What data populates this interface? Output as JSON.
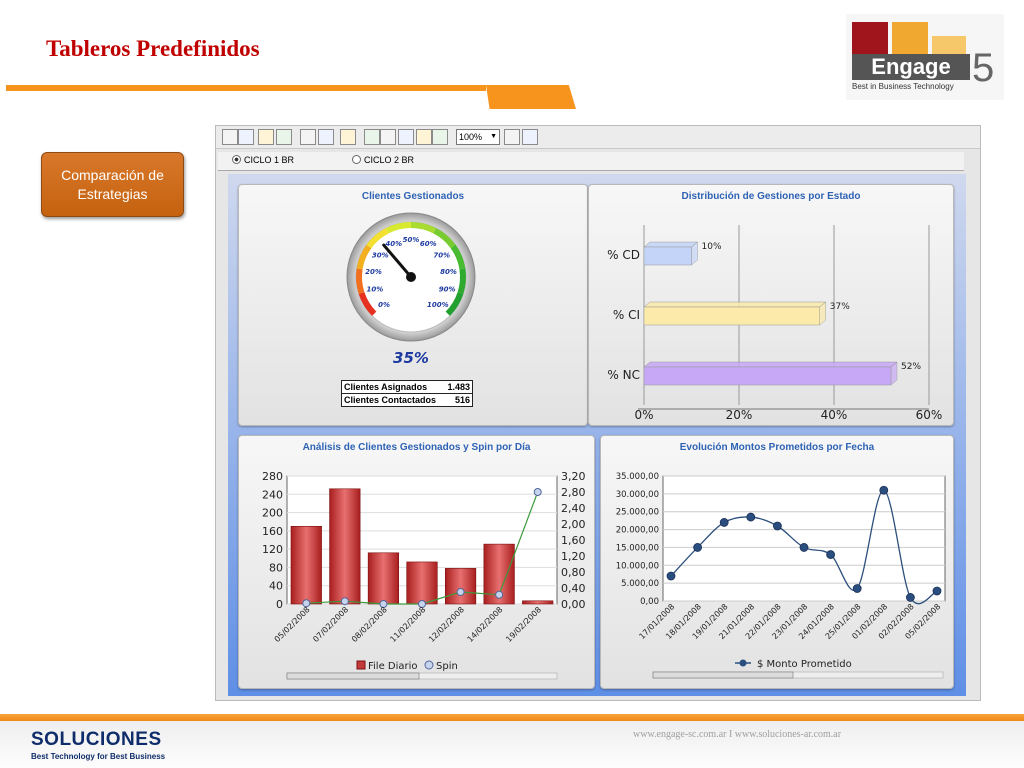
{
  "slide": {
    "title": "Tableros Predefinidos"
  },
  "logo": {
    "word": "Engage",
    "number": "5",
    "reg": "®",
    "tagline": "Best in Business Technology",
    "colors": [
      "#a0151c",
      "#f0a830",
      "#f6c86a"
    ]
  },
  "side_button": {
    "line1": "Comparación de",
    "line2": "Estrategias"
  },
  "app": {
    "zoom": "100%",
    "radio_options": [
      {
        "label": "CICLO 1 BR",
        "selected": true
      },
      {
        "label": "CICLO 2 BR",
        "selected": false
      }
    ],
    "toolbar_icons": [
      "edit-icon",
      "new-page-icon",
      "select-icon",
      "page-icon",
      "save-icon",
      "print-icon",
      "settings-icon",
      "refresh-icon",
      "help-icon",
      "document-icon",
      "export-icon",
      "pdf-icon",
      "export-excel-icon",
      "import-icon"
    ]
  },
  "panels": {
    "gauge": {
      "title": "Clientes Gestionados",
      "value_label": "35%",
      "value": 35,
      "ticks": [
        "0%",
        "10%",
        "20%",
        "30%",
        "40%",
        "50%",
        "60%",
        "70%",
        "80%",
        "90%",
        "100%"
      ],
      "table": [
        {
          "label": "Clientes Asignados",
          "value": "1.483"
        },
        {
          "label": "Clientes Contactados",
          "value": "516"
        }
      ]
    },
    "distribution": {
      "title": "Distribución de Gestiones por Estado"
    },
    "analysis": {
      "title": "Análisis de Clientes Gestionados y Spin por Día",
      "legend": [
        "File Diario",
        "Spin"
      ]
    },
    "evolution": {
      "title": "Evolución Montos Prometidos por Fecha",
      "legend": "$ Monto Prometido"
    }
  },
  "chart_data": [
    {
      "type": "bar",
      "title": "Distribución de Gestiones por Estado",
      "orientation": "horizontal",
      "categories": [
        "% CD",
        "% CI",
        "% NC"
      ],
      "values": [
        10,
        37,
        52
      ],
      "data_labels": [
        "10%",
        "37%",
        "52%"
      ],
      "colors": [
        "#c4d4f8",
        "#fbeaaa",
        "#c7a8f6"
      ],
      "x_ticks": [
        "0%",
        "20%",
        "40%",
        "60%"
      ],
      "xlim": [
        0,
        60
      ]
    },
    {
      "type": "bar",
      "title": "Análisis de Clientes Gestionados y Spin por Día",
      "categories": [
        "05/02/2008",
        "07/02/2008",
        "08/02/2008",
        "11/02/2008",
        "12/02/2008",
        "14/02/2008",
        "19/02/2008"
      ],
      "series": [
        {
          "name": "File Diario",
          "type": "bar",
          "axis": "left",
          "values": [
            170,
            252,
            112,
            92,
            78,
            131,
            7
          ],
          "color": "#c43a3a"
        },
        {
          "name": "Spin",
          "type": "line",
          "axis": "right",
          "values": [
            0.02,
            0.07,
            0.0,
            0.0,
            0.3,
            0.23,
            2.8
          ],
          "color": "#3a9a3a"
        }
      ],
      "y_ticks_left": [
        "0",
        "40",
        "80",
        "120",
        "160",
        "200",
        "240",
        "280"
      ],
      "y_ticks_right": [
        "0,00",
        "0,40",
        "0,80",
        "1,20",
        "1,60",
        "2,00",
        "2,40",
        "2,80",
        "3,20"
      ],
      "ylim_left": [
        0,
        280
      ],
      "ylim_right": [
        0,
        3.2
      ],
      "grid": true
    },
    {
      "type": "line",
      "title": "Evolución Montos Prometidos por Fecha",
      "categories": [
        "17/01/2008",
        "18/01/2008",
        "19/01/2008",
        "21/01/2008",
        "22/01/2008",
        "23/01/2008",
        "24/01/2008",
        "25/01/2008",
        "01/02/2008",
        "02/02/2008",
        "05/02/2008"
      ],
      "series": [
        {
          "name": "$ Monto Prometido",
          "values": [
            7000,
            15000,
            22000,
            23500,
            21000,
            15000,
            13000,
            3500,
            31000,
            1000,
            2800
          ],
          "color": "#2c4f7c"
        }
      ],
      "y_ticks": [
        "0,00",
        "5.000,00",
        "10.000,00",
        "15.000,00",
        "20.000,00",
        "25.000,00",
        "30.000,00",
        "35.000,00"
      ],
      "ylim": [
        0,
        35000
      ],
      "smooth": true,
      "grid": true
    }
  ],
  "footer": {
    "brand": "SOLUCIONES",
    "tagline": "Best Technology for Best Business",
    "websites": "www.engage-sc.com.ar  I  www.soluciones-ar.com.ar"
  }
}
